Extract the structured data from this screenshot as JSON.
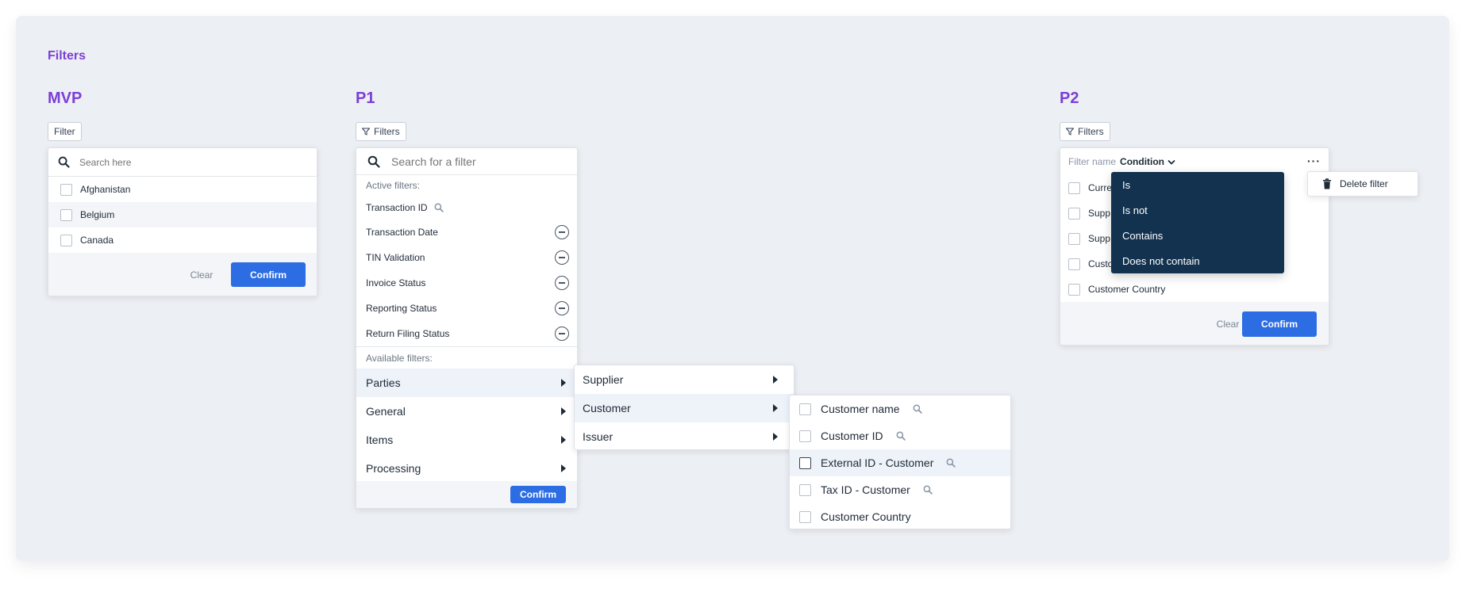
{
  "page": {
    "title": "Filters"
  },
  "mvp": {
    "title": "MVP",
    "button_label": "Filter",
    "search_placeholder": "Search here",
    "items": [
      {
        "label": "Afghanistan"
      },
      {
        "label": "Belgium"
      },
      {
        "label": "Canada"
      }
    ],
    "clear_label": "Clear",
    "confirm_label": "Confirm"
  },
  "p1": {
    "title": "P1",
    "button_label": "Filters",
    "search_placeholder": "Search for a filter",
    "active_header": "Active filters:",
    "active": [
      {
        "label": "Transaction ID"
      },
      {
        "label": "Transaction Date"
      },
      {
        "label": "TIN Validation"
      },
      {
        "label": "Invoice Status"
      },
      {
        "label": "Reporting Status"
      },
      {
        "label": "Return Filing Status"
      }
    ],
    "available_header": "Available filters:",
    "available": [
      {
        "label": "Parties"
      },
      {
        "label": "General"
      },
      {
        "label": "Items"
      },
      {
        "label": "Processing"
      }
    ],
    "confirm_label": "Confirm",
    "submenu": [
      {
        "label": "Supplier"
      },
      {
        "label": "Customer"
      },
      {
        "label": "Issuer"
      }
    ],
    "customer_fields": [
      {
        "label": "Customer name"
      },
      {
        "label": "Customer ID"
      },
      {
        "label": "External ID - Customer"
      },
      {
        "label": "Tax ID - Customer"
      },
      {
        "label": "Customer Country"
      }
    ]
  },
  "p2": {
    "title": "P2",
    "button_label": "Filters",
    "filter_name_label": "Filter name",
    "condition_label": "Condition",
    "items_visible": [
      {
        "label": "Curre"
      },
      {
        "label": "Supp"
      },
      {
        "label": "Supp"
      },
      {
        "label": "Custo"
      },
      {
        "label": "Customer Country"
      }
    ],
    "conditions": [
      {
        "label": "Is"
      },
      {
        "label": "Is not"
      },
      {
        "label": "Contains"
      },
      {
        "label": "Does not contain"
      }
    ],
    "delete_label": "Delete filter",
    "clear_label": "Clear",
    "confirm_label": "Confirm"
  },
  "colors": {
    "accent": "#7b3fd6",
    "primary": "#2d6de3",
    "dark_menu": "#12324f",
    "board": "#eceff3"
  }
}
